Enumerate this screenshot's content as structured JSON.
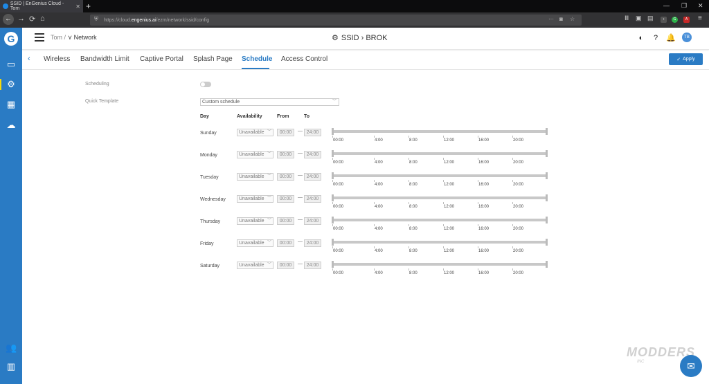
{
  "browser": {
    "tab_title": "SSID | EnGenius Cloud - Tom",
    "url_prefix": "https://cloud.",
    "url_domain": "engenius.ai",
    "url_path": "/ezm/network/ssid/config"
  },
  "header": {
    "breadcrumb_user": "Tom",
    "breadcrumb_sep": "/",
    "breadcrumb_network": "Network",
    "title": "SSID › BROK",
    "avatar_initials": "TB"
  },
  "tabs": [
    {
      "label": "Wireless"
    },
    {
      "label": "Bandwidth Limit"
    },
    {
      "label": "Captive Portal"
    },
    {
      "label": "Splash Page"
    },
    {
      "label": "Schedule"
    },
    {
      "label": "Access Control"
    }
  ],
  "apply_label": "Apply",
  "form": {
    "scheduling_label": "Scheduling",
    "scheduling_on": false,
    "template_label": "Quick Template",
    "template_value": "Custom schedule"
  },
  "columns": {
    "day": "Day",
    "availability": "Availability",
    "from": "From",
    "to": "To"
  },
  "hour_labels": [
    "00:00",
    "4:00",
    "8:00",
    "12:00",
    "16:00",
    "20:00"
  ],
  "days": [
    {
      "name": "Sunday",
      "availability": "Unavailable",
      "from": "00:00",
      "to": "24:00"
    },
    {
      "name": "Monday",
      "availability": "Unavailable",
      "from": "00:00",
      "to": "24:00"
    },
    {
      "name": "Tuesday",
      "availability": "Unavailable",
      "from": "00:00",
      "to": "24:00"
    },
    {
      "name": "Wednesday",
      "availability": "Unavailable",
      "from": "00:00",
      "to": "24:00"
    },
    {
      "name": "Thursday",
      "availability": "Unavailable",
      "from": "00:00",
      "to": "24:00"
    },
    {
      "name": "Friday",
      "availability": "Unavailable",
      "from": "00:00",
      "to": "24:00"
    },
    {
      "name": "Saturday",
      "availability": "Unavailable",
      "from": "00:00",
      "to": "24:00"
    }
  ],
  "watermark": {
    "main": "MODDERS",
    "sub": "INC"
  },
  "colors": {
    "accent": "#2a7bc4",
    "sidebar_active": "#f5d90a"
  }
}
